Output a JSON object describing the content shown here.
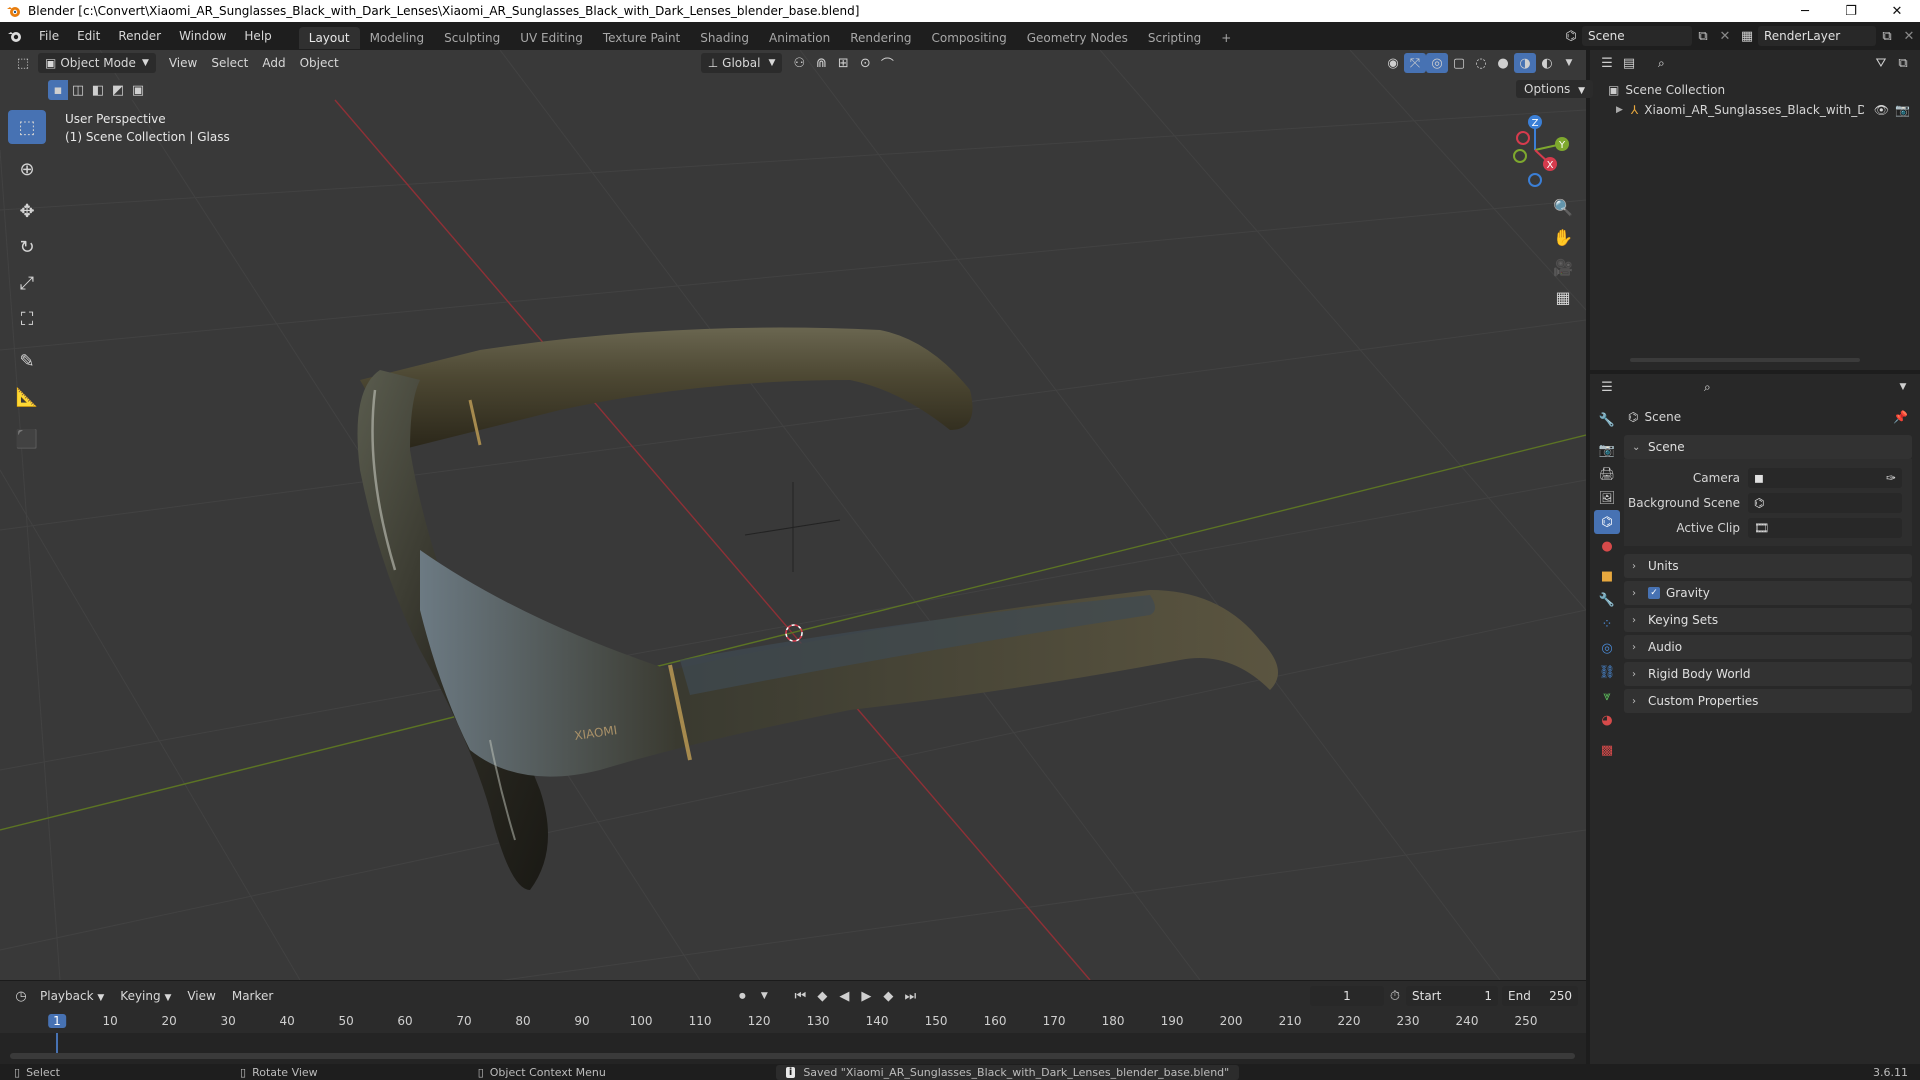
{
  "window": {
    "title": "Blender [c:\\Convert\\Xiaomi_AR_Sunglasses_Black_with_Dark_Lenses\\Xiaomi_AR_Sunglasses_Black_with_Dark_Lenses_blender_base.blend]",
    "minimize": "─",
    "maximize": "❐",
    "close": "✕"
  },
  "menu": [
    "File",
    "Edit",
    "Render",
    "Window",
    "Help"
  ],
  "workspaces": [
    "Layout",
    "Modeling",
    "Sculpting",
    "UV Editing",
    "Texture Paint",
    "Shading",
    "Animation",
    "Rendering",
    "Compositing",
    "Geometry Nodes",
    "Scripting",
    "+"
  ],
  "active_workspace": "Layout",
  "scene_field": "Scene",
  "renderlayer_field": "RenderLayer",
  "viewport": {
    "mode": "Object Mode",
    "menus": [
      "View",
      "Select",
      "Add",
      "Object"
    ],
    "transform_orientation": "Global",
    "options_label": "Options",
    "perspective": "User Perspective",
    "collection_info": "(1) Scene Collection | Glass",
    "gizmo_axes": {
      "x": "X",
      "y": "Y",
      "z": "Z"
    },
    "logo_text": "XIAOMI"
  },
  "outliner": {
    "scene_collection": "Scene Collection",
    "object": "Xiaomi_AR_Sunglasses_Black_with_Dar"
  },
  "properties": {
    "context": "Scene",
    "section": "Scene",
    "fields": [
      {
        "label": "Camera",
        "value": ""
      },
      {
        "label": "Background Scene",
        "value": ""
      },
      {
        "label": "Active Clip",
        "value": ""
      }
    ],
    "panels": [
      "Units",
      "Gravity",
      "Keying Sets",
      "Audio",
      "Rigid Body World",
      "Custom Properties"
    ],
    "gravity_checked": true
  },
  "timeline": {
    "menus": [
      "Playback",
      "Keying",
      "View",
      "Marker"
    ],
    "current_frame": "1",
    "start_label": "Start",
    "start": "1",
    "end_label": "End",
    "end": "250",
    "ticks": [
      "1",
      "10",
      "20",
      "30",
      "40",
      "50",
      "60",
      "70",
      "80",
      "90",
      "100",
      "110",
      "120",
      "130",
      "140",
      "150",
      "160",
      "170",
      "180",
      "190",
      "200",
      "210",
      "220",
      "230",
      "240",
      "250"
    ]
  },
  "status": {
    "select": "Select",
    "rotate": "Rotate View",
    "context_menu": "Object Context Menu",
    "message": "Saved \"Xiaomi_AR_Sunglasses_Black_with_Dark_Lenses_blender_base.blend\"",
    "version": "3.6.11"
  },
  "colors": {
    "accent": "#4772b3",
    "x_axis": "#d63b4d",
    "y_axis": "#7ea82e",
    "z_axis": "#3b7fd6"
  }
}
